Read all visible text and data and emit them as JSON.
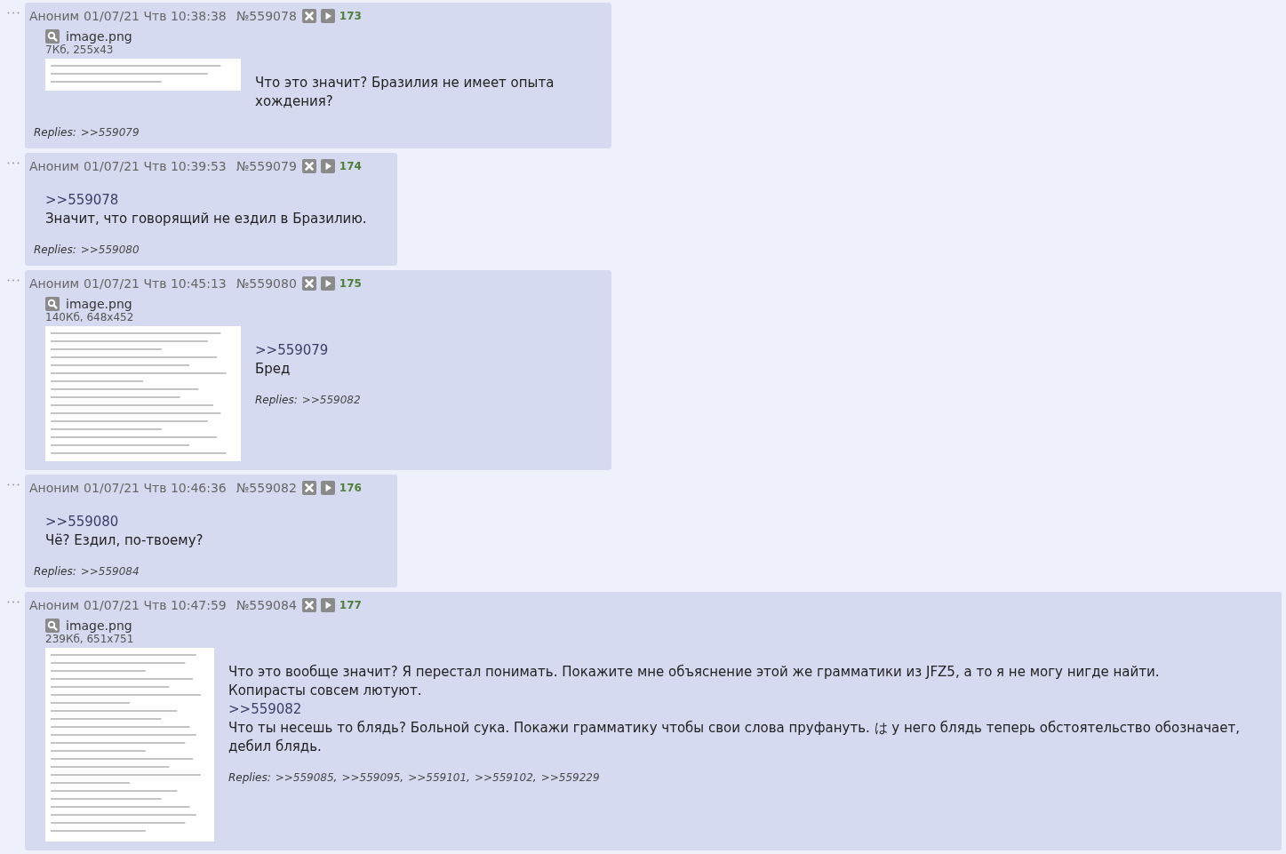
{
  "posts": [
    {
      "author": "Аноним",
      "date": "01/07/21 Чтв 10:38:38",
      "number": "№559078",
      "counter": "173",
      "file": {
        "name": "image.png",
        "info": "7Кб, 255x43"
      },
      "message": [
        {
          "kind": "text",
          "text": "Что это значит? Бразилия не имеет опыта\nхождения?"
        }
      ],
      "replies": {
        "label": "Replies:",
        "links": [
          ">>559079"
        ]
      }
    },
    {
      "author": "Аноним",
      "date": "01/07/21 Чтв 10:39:53",
      "number": "№559079",
      "counter": "174",
      "message": [
        {
          "kind": "link",
          "text": ">>559078"
        },
        {
          "kind": "text",
          "text": "Значит, что говорящий не ездил в Бразилию."
        }
      ],
      "replies": {
        "label": "Replies:",
        "links": [
          ">>559080"
        ]
      }
    },
    {
      "author": "Аноним",
      "date": "01/07/21 Чтв 10:45:13",
      "number": "№559080",
      "counter": "175",
      "file": {
        "name": "image.png",
        "info": "140Кб, 648x452"
      },
      "message": [
        {
          "kind": "link",
          "text": ">>559079"
        },
        {
          "kind": "text",
          "text": "Бред"
        }
      ],
      "replies": {
        "label": "Replies:",
        "links": [
          ">>559082"
        ]
      }
    },
    {
      "author": "Аноним",
      "date": "01/07/21 Чтв 10:46:36",
      "number": "№559082",
      "counter": "176",
      "message": [
        {
          "kind": "link",
          "text": ">>559080"
        },
        {
          "kind": "text",
          "text": "Чё? Ездил, по-твоему?"
        }
      ],
      "replies": {
        "label": "Replies:",
        "links": [
          ">>559084"
        ]
      }
    },
    {
      "author": "Аноним",
      "date": "01/07/21 Чтв 10:47:59",
      "number": "№559084",
      "counter": "177",
      "file": {
        "name": "image.png",
        "info": "239Кб, 651x751"
      },
      "message": [
        {
          "kind": "text",
          "text": "Что это вообще значит? Я перестал понимать. Покажите мне объяснение этой же грамматики из JFZ5, а то я не могу нигде найти."
        },
        {
          "kind": "text",
          "text": "Копирасты совсем лютуют."
        },
        {
          "kind": "link",
          "text": ">>559082"
        },
        {
          "kind": "text",
          "text": "Что ты несешь то блядь? Больной сука. Покажи грамматику чтобы свои слова пруфануть. は у него блядь теперь обстоятельство обозначает, дебил блядь."
        }
      ],
      "replies": {
        "label": "Replies:",
        "links": [
          ">>559085",
          ">>559095",
          ">>559101",
          ">>559102",
          ">>559229"
        ],
        "separator": ","
      }
    }
  ]
}
